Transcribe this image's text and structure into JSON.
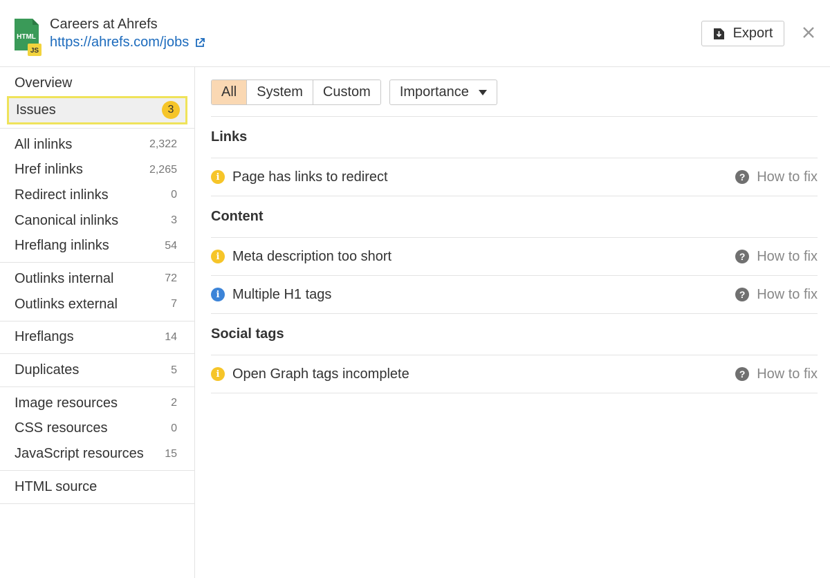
{
  "header": {
    "title": "Careers at Ahrefs",
    "url": "https://ahrefs.com/jobs",
    "file_icon_label": "HTML",
    "file_icon_badge": "JS",
    "export_label": "Export",
    "icons": [
      "file-html-icon",
      "external-link-icon",
      "download-icon",
      "close-icon"
    ]
  },
  "sidebar": {
    "groups": [
      [
        {
          "label": "Overview",
          "count": ""
        },
        {
          "label": "Issues",
          "count": "3",
          "active": true
        }
      ],
      [
        {
          "label": "All inlinks",
          "count": "2,322"
        },
        {
          "label": "Href inlinks",
          "count": "2,265"
        },
        {
          "label": "Redirect inlinks",
          "count": "0"
        },
        {
          "label": "Canonical inlinks",
          "count": "3"
        },
        {
          "label": "Hreflang inlinks",
          "count": "54"
        }
      ],
      [
        {
          "label": "Outlinks internal",
          "count": "72"
        },
        {
          "label": "Outlinks external",
          "count": "7"
        }
      ],
      [
        {
          "label": "Hreflangs",
          "count": "14"
        }
      ],
      [
        {
          "label": "Duplicates",
          "count": "5"
        }
      ],
      [
        {
          "label": "Image resources",
          "count": "2"
        },
        {
          "label": "CSS resources",
          "count": "0"
        },
        {
          "label": "JavaScript resources",
          "count": "15"
        }
      ],
      [
        {
          "label": "HTML source",
          "count": ""
        }
      ]
    ]
  },
  "filters": {
    "tabs": [
      "All",
      "System",
      "Custom"
    ],
    "selected": "All",
    "dropdown_label": "Importance"
  },
  "sections": [
    {
      "title": "Links",
      "issues": [
        {
          "label": "Page has links to redirect",
          "severity": "warning",
          "color": "#f6c529"
        }
      ]
    },
    {
      "title": "Content",
      "issues": [
        {
          "label": "Meta description too short",
          "severity": "warning",
          "color": "#f6c529"
        },
        {
          "label": "Multiple H1 tags",
          "severity": "notice",
          "color": "#3c84d8"
        }
      ]
    },
    {
      "title": "Social tags",
      "issues": [
        {
          "label": "Open Graph tags incomplete",
          "severity": "warning",
          "color": "#f6c529"
        }
      ]
    }
  ],
  "how_to_fix_label": "How to fix",
  "colors": {
    "accent_link": "#1c6bbd",
    "selected_tab": "#fad8b3",
    "highlight_border": "#efe35a",
    "warning": "#f6c529",
    "notice": "#3c84d8"
  }
}
